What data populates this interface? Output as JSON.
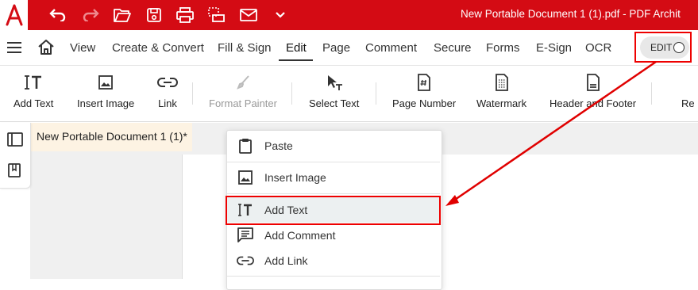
{
  "titlebar": {
    "document_title": "New Portable Document 1 (1).pdf  -  PDF Archit",
    "brand_color": "#d40b14"
  },
  "menubar": {
    "items": [
      "View",
      "Create & Convert",
      "Fill & Sign",
      "Edit",
      "Page",
      "Comment",
      "Secure",
      "Forms",
      "E-Sign",
      "OCR"
    ],
    "active": "Edit",
    "edit_toggle_label": "EDIT"
  },
  "toolbar": {
    "tools": [
      {
        "label": "Add Text",
        "icon": "add-text-icon",
        "enabled": true
      },
      {
        "label": "Insert Image",
        "icon": "image-icon",
        "enabled": true
      },
      {
        "label": "Link",
        "icon": "link-icon",
        "enabled": true
      },
      {
        "label": "Format Painter",
        "icon": "brush-icon",
        "enabled": false
      },
      {
        "label": "Select Text",
        "icon": "select-text-icon",
        "enabled": true
      },
      {
        "label": "Page Number",
        "icon": "page-number-icon",
        "enabled": true
      },
      {
        "label": "Watermark",
        "icon": "watermark-icon",
        "enabled": true
      },
      {
        "label": "Header and Footer",
        "icon": "header-footer-icon",
        "enabled": true
      },
      {
        "label": "Re",
        "icon": "",
        "enabled": true
      }
    ]
  },
  "document": {
    "tab_label": "New Portable Document 1 (1)*"
  },
  "context_menu": {
    "items": [
      {
        "label": "Paste",
        "icon": "clipboard-icon"
      },
      {
        "label": "Insert Image",
        "icon": "image-icon"
      },
      {
        "label": "Add Text",
        "icon": "add-text-icon",
        "highlighted": true
      },
      {
        "label": "Add Comment",
        "icon": "comment-icon"
      },
      {
        "label": "Add Link",
        "icon": "link-icon"
      }
    ]
  },
  "annotation_color": "#e00000"
}
